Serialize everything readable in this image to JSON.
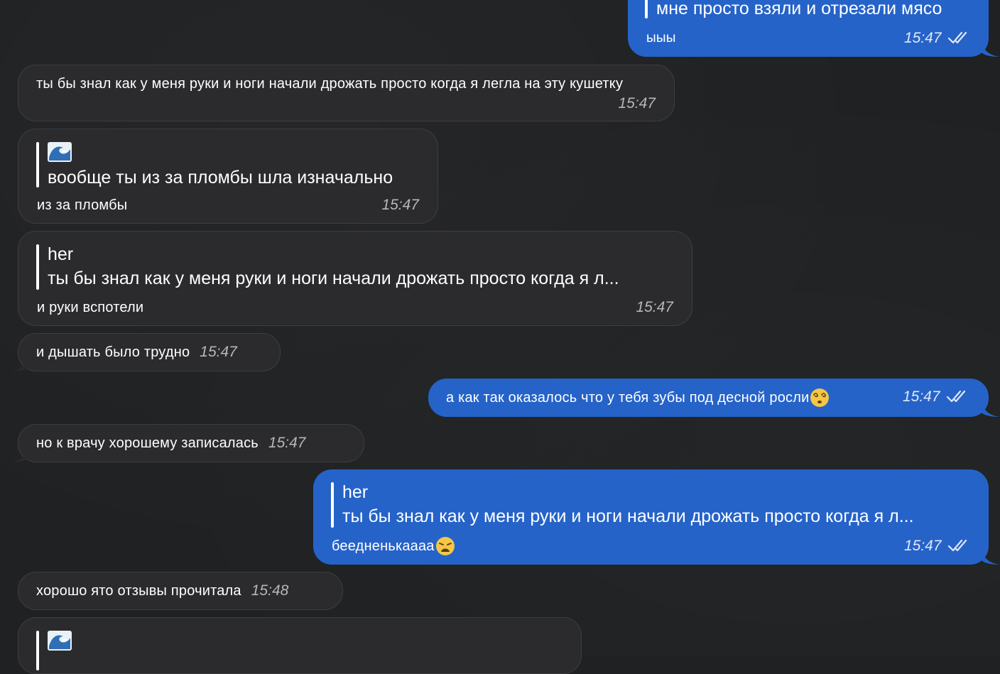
{
  "messages": [
    {
      "quote_text": "мне просто взяли и отрезали мясо",
      "text": "ыыы",
      "time": "15:47"
    },
    {
      "text": "ты бы знал как у меня руки и ноги начали дрожать просто когда я легла на эту кушетку",
      "time": "15:47"
    },
    {
      "quote_emoji": "wave-emoji-icon",
      "quote_text": "вообще ты из за пломбы шла изначально",
      "text": "из за пломбы",
      "time": "15:47"
    },
    {
      "quote_author": "her",
      "quote_text": "ты бы знал как у меня руки и ноги начали дрожать просто когда я л...",
      "text": "и руки вспотели",
      "time": "15:47"
    },
    {
      "text": "и дышать было трудно",
      "time": "15:47"
    },
    {
      "text": "а как так оказалось что у тебя зубы под десной росли",
      "emoji": "dizzy-face-emoji-icon",
      "time": "15:47"
    },
    {
      "text": "но к врачу хорошему записалась",
      "time": "15:47"
    },
    {
      "quote_author": "her",
      "quote_text": "ты бы знал как у меня руки и ноги начали дрожать просто когда я л...",
      "text": "беедненькаааа",
      "emoji": "weary-face-emoji-icon",
      "time": "15:47"
    },
    {
      "text": "хорошо ято отзывы прочитала",
      "time": "15:48"
    },
    {
      "quote_emoji": "wave-emoji-icon"
    }
  ],
  "colors": {
    "background": "#1f2123",
    "incoming_bubble": "#2b2b2d",
    "outgoing_bubble": "#2563c9"
  }
}
